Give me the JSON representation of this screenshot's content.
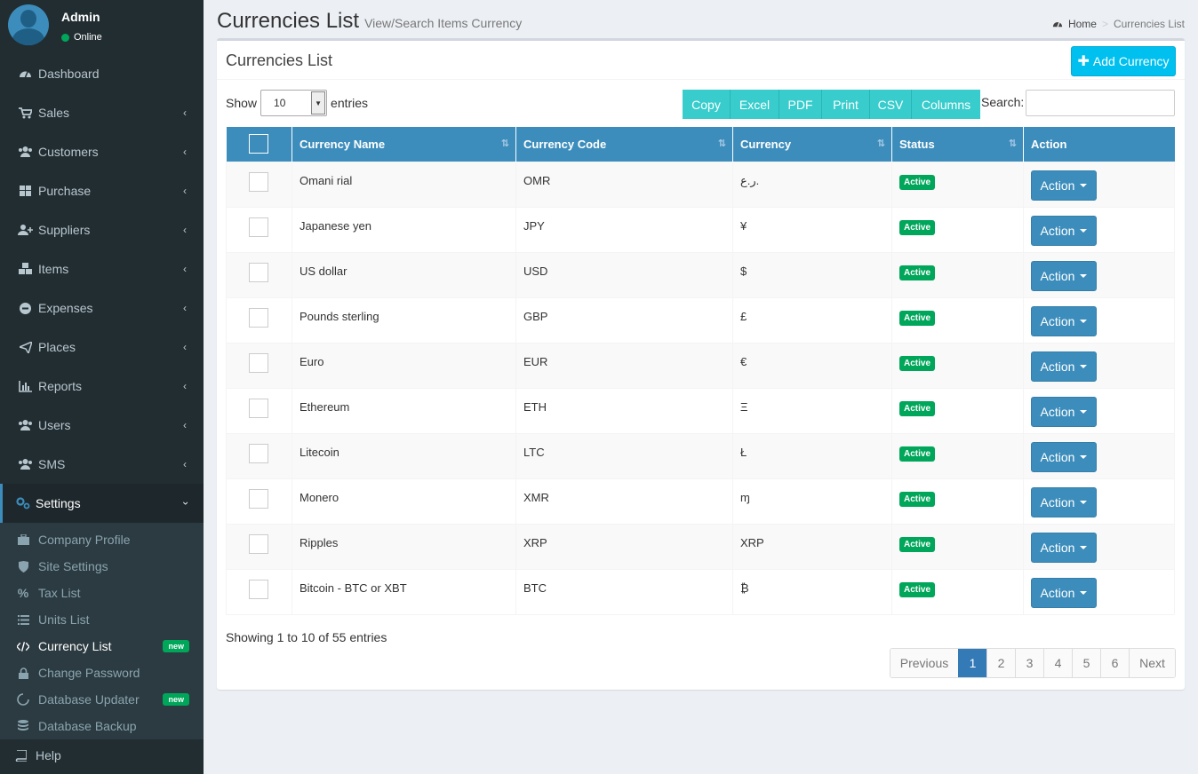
{
  "user": {
    "name": "Admin",
    "status": "Online"
  },
  "menu": [
    {
      "label": "Dashboard",
      "icon": "dashboard-icon"
    },
    {
      "label": "Sales",
      "icon": "cart-icon"
    },
    {
      "label": "Customers",
      "icon": "users-icon"
    },
    {
      "label": "Purchase",
      "icon": "grid-icon"
    },
    {
      "label": "Suppliers",
      "icon": "user-plus-icon"
    },
    {
      "label": "Items",
      "icon": "cubes-icon"
    },
    {
      "label": "Expenses",
      "icon": "minus-circle-icon"
    },
    {
      "label": "Places",
      "icon": "paper-plane-icon"
    },
    {
      "label": "Reports",
      "icon": "bar-chart-icon"
    },
    {
      "label": "Users",
      "icon": "users-icon"
    },
    {
      "label": "SMS",
      "icon": "users-icon"
    },
    {
      "label": "Settings",
      "icon": "gears-icon"
    }
  ],
  "submenu": [
    {
      "label": "Company Profile",
      "icon": "briefcase-icon"
    },
    {
      "label": "Site Settings",
      "icon": "shield-icon"
    },
    {
      "label": "Tax List",
      "icon": "percent-icon"
    },
    {
      "label": "Units List",
      "icon": "list-icon"
    },
    {
      "label": "Currency List",
      "icon": "code-icon",
      "badge": "new"
    },
    {
      "label": "Change Password",
      "icon": "lock-icon"
    },
    {
      "label": "Database Updater",
      "icon": "refresh-icon",
      "badge": "new"
    },
    {
      "label": "Database Backup",
      "icon": "database-icon"
    }
  ],
  "help": "Help",
  "header": {
    "title": "Currencies List",
    "subtitle": "View/Search Items Currency"
  },
  "breadcrumb": {
    "home": "Home",
    "current": "Currencies List"
  },
  "box": {
    "title": "Currencies List",
    "add_button": "Add Currency"
  },
  "length": {
    "show": "Show",
    "value": "10",
    "entries": "entries"
  },
  "export_buttons": [
    "Copy",
    "Excel",
    "PDF",
    "Print",
    "CSV",
    "Columns"
  ],
  "search": {
    "label": "Search:",
    "value": ""
  },
  "columns": [
    "Currency Name",
    "Currency Code",
    "Currency",
    "Status",
    "Action"
  ],
  "rows": [
    {
      "name": "Omani rial",
      "code": "OMR",
      "symbol": "ر.ع.",
      "status": "Active",
      "action": "Action"
    },
    {
      "name": "Japanese yen",
      "code": "JPY",
      "symbol": "¥",
      "status": "Active",
      "action": "Action"
    },
    {
      "name": "US dollar",
      "code": "USD",
      "symbol": "$",
      "status": "Active",
      "action": "Action"
    },
    {
      "name": "Pounds sterling",
      "code": "GBP",
      "symbol": "£",
      "status": "Active",
      "action": "Action"
    },
    {
      "name": "Euro",
      "code": "EUR",
      "symbol": "€",
      "status": "Active",
      "action": "Action"
    },
    {
      "name": "Ethereum",
      "code": "ETH",
      "symbol": "Ξ",
      "status": "Active",
      "action": "Action"
    },
    {
      "name": "Litecoin",
      "code": "LTC",
      "symbol": "Ł",
      "status": "Active",
      "action": "Action"
    },
    {
      "name": "Monero",
      "code": "XMR",
      "symbol": "ɱ",
      "status": "Active",
      "action": "Action"
    },
    {
      "name": "Ripples",
      "code": "XRP",
      "symbol": "XRP",
      "status": "Active",
      "action": "Action"
    },
    {
      "name": "Bitcoin - BTC or XBT",
      "code": "BTC",
      "symbol": "₿",
      "status": "Active",
      "action": "Action"
    }
  ],
  "info": "Showing 1 to 10 of 55 entries",
  "pagination": {
    "previous": "Previous",
    "pages": [
      "1",
      "2",
      "3",
      "4",
      "5",
      "6"
    ],
    "current": "1",
    "next": "Next"
  },
  "colors": {
    "sidebar": "#222d32",
    "primary": "#3c8dbc",
    "teal": "#39cccc",
    "aqua": "#00c0ef",
    "success": "#00a65a"
  }
}
